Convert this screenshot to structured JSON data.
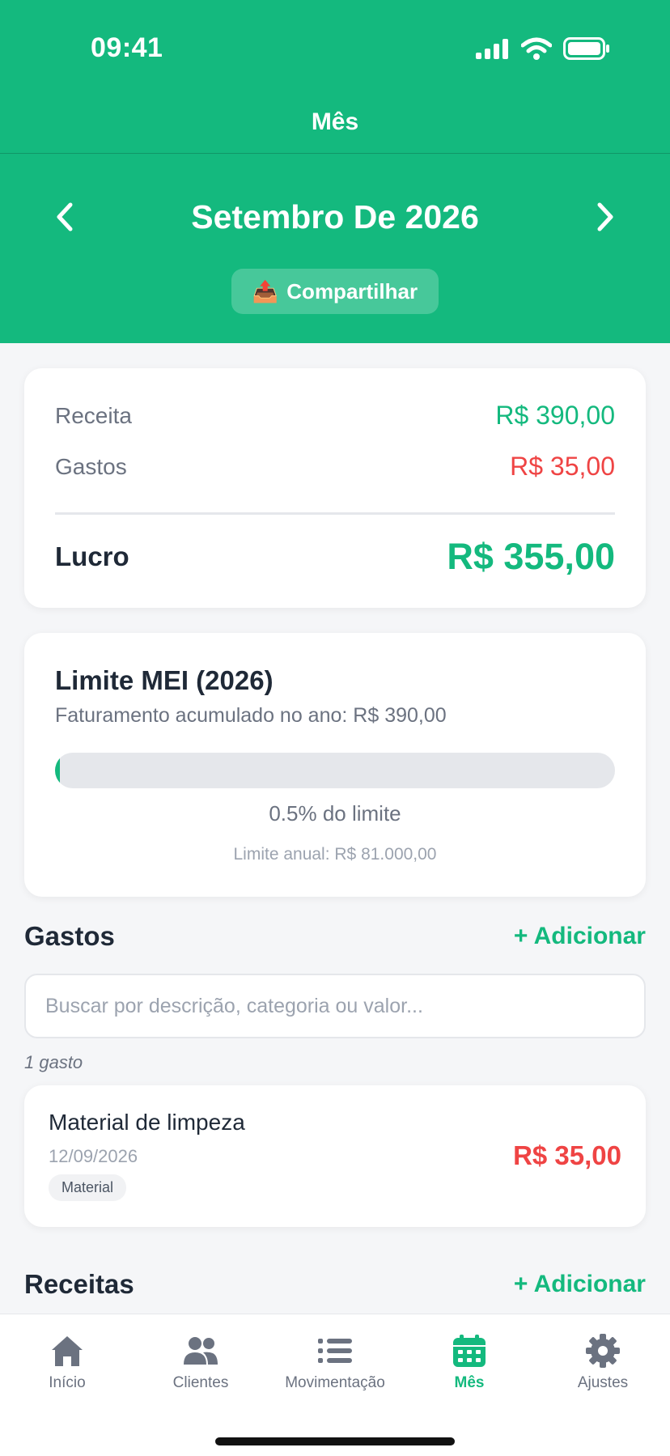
{
  "status_bar": {
    "time": "09:41"
  },
  "nav": {
    "title": "Mês"
  },
  "month": {
    "title": "Setembro De 2026",
    "share_label": "Compartilhar",
    "share_emoji": "📤"
  },
  "summary": {
    "revenue_label": "Receita",
    "revenue_value": "R$ 390,00",
    "expenses_label": "Gastos",
    "expenses_value": "R$ 35,00",
    "profit_label": "Lucro",
    "profit_value": "R$ 355,00"
  },
  "mei": {
    "title": "Limite MEI (2026)",
    "subtitle": "Faturamento acumulado no ano: R$ 390,00",
    "progress_percent": 0.5,
    "percent_label": "0.5% do limite",
    "annual_limit": "Limite anual: R$ 81.000,00"
  },
  "expenses_section": {
    "title": "Gastos",
    "add_label": "+ Adicionar",
    "search_placeholder": "Buscar por descrição, categoria ou valor...",
    "count_label": "1 gasto",
    "items": [
      {
        "name": "Material de limpeza",
        "date": "12/09/2026",
        "tag": "Material",
        "value": "R$ 35,00"
      }
    ]
  },
  "revenues_section": {
    "title": "Receitas",
    "add_label": "+ Adicionar"
  },
  "tabbar": {
    "items": [
      {
        "label": "Início",
        "icon": "home-icon"
      },
      {
        "label": "Clientes",
        "icon": "users-icon"
      },
      {
        "label": "Movimentação",
        "icon": "list-icon"
      },
      {
        "label": "Mês",
        "icon": "calendar-icon",
        "active": true
      },
      {
        "label": "Ajustes",
        "icon": "gear-icon"
      }
    ]
  },
  "colors": {
    "brand": "#14b97e",
    "negative": "#ef4444",
    "text": "#1f2937",
    "muted": "#6b7280"
  }
}
